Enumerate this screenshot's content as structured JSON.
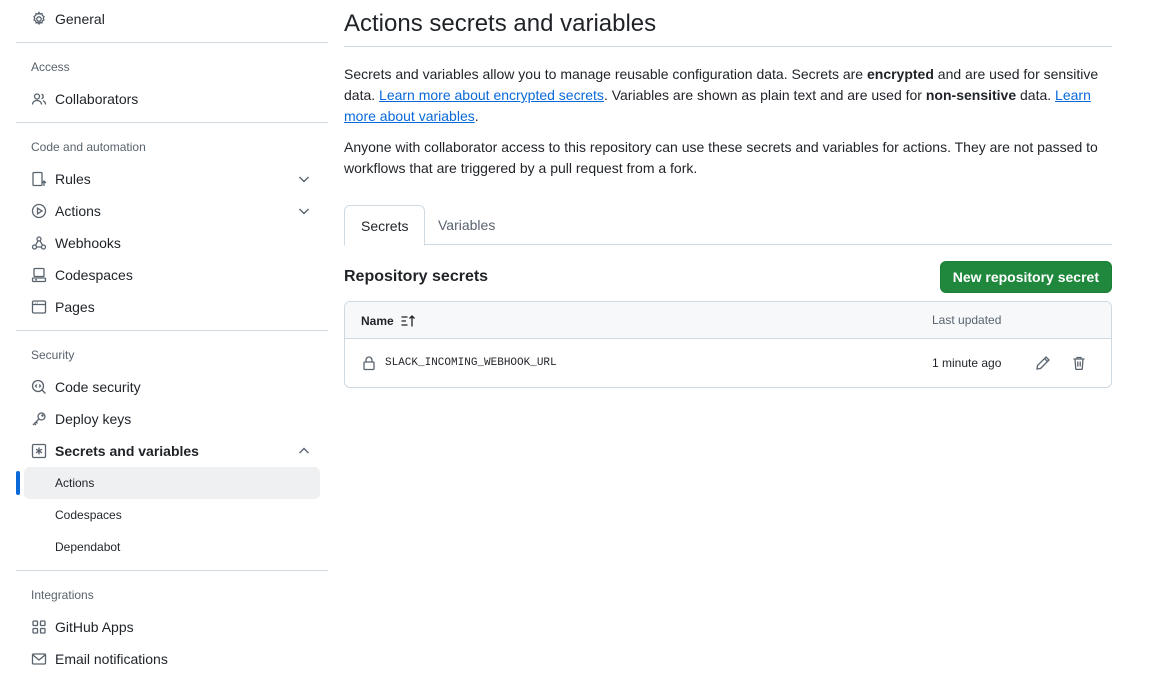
{
  "sidebar": {
    "general": "General",
    "sections": {
      "access": "Access",
      "code_automation": "Code and automation",
      "security": "Security",
      "integrations": "Integrations"
    },
    "items": {
      "collaborators": "Collaborators",
      "rules": "Rules",
      "actions": "Actions",
      "webhooks": "Webhooks",
      "codespaces": "Codespaces",
      "pages": "Pages",
      "code_security": "Code security",
      "deploy_keys": "Deploy keys",
      "secrets_variables": "Secrets and variables",
      "github_apps": "GitHub Apps",
      "email_notifications": "Email notifications"
    },
    "sub_items": {
      "actions": "Actions",
      "codespaces": "Codespaces",
      "dependabot": "Dependabot"
    }
  },
  "main": {
    "title": "Actions secrets and variables",
    "desc1": {
      "t1": "Secrets and variables allow you to manage reusable configuration data. Secrets are ",
      "b1": "encrypted",
      "t2": " and are used for sensitive data. ",
      "link1": "Learn more about encrypted secrets",
      "t3": ". Variables are shown as plain text and are used for ",
      "b2": "non-sensitive",
      "t4": " data. ",
      "link2": "Learn more about variables",
      "t5": "."
    },
    "desc2": "Anyone with collaborator access to this repository can use these secrets and variables for actions. They are not passed to workflows that are triggered by a pull request from a fork.",
    "tabs": [
      "Secrets",
      "Variables"
    ],
    "repo_heading": "Repository secrets",
    "new_secret_button": "New repository secret",
    "table": {
      "col_name": "Name",
      "col_updated": "Last updated",
      "rows": [
        {
          "name": "SLACK_INCOMING_WEBHOOK_URL",
          "updated": "1 minute ago"
        }
      ]
    }
  },
  "colors": {
    "accent": "#0969da",
    "primary_button": "#1f883d",
    "active_nav_bg": "#eef0f2",
    "border": "#d1d9e0",
    "muted_text": "#59636e"
  }
}
